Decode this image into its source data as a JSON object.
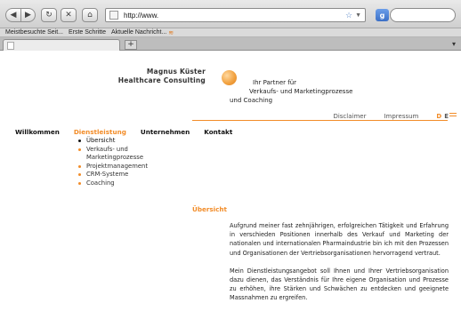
{
  "browser": {
    "url": "http://www.",
    "bookmarks": [
      "Meistbesuchte Seit...",
      "Erste Schritte",
      "Aktuelle Nachricht..."
    ],
    "new_tab_label": "+",
    "search_engine_label": "g"
  },
  "site": {
    "company_line1": "Magnus Küster",
    "company_line2": "Healthcare Consulting",
    "tagline_line1": "Ihr Partner für",
    "tagline_line2": "Verkaufs- und Marketingprozesse",
    "tagline_line3": "und Coaching",
    "accent_color": "#f28c28"
  },
  "service_links": {
    "disclaimer": "Disclaimer",
    "impressum": "Impressum",
    "lang_de": "D",
    "lang_en": "E"
  },
  "main_nav": {
    "willkommen": "Willkommen",
    "dienstleistung": "Dienstleistung",
    "unternehmen": "Unternehmen",
    "kontakt": "Kontakt"
  },
  "sub_nav": {
    "uebersicht": "Übersicht",
    "verkauf_line1": "Verkaufs- und",
    "verkauf_line2": "Marketingprozesse",
    "projektmanagement": "Projektmanagement",
    "crm": "CRM-Systeme",
    "coaching": "Coaching"
  },
  "content": {
    "title": "Übersicht",
    "paragraph1": "Aufgrund meiner fast zehnjährigen, erfolgreichen Tätigkeit und Erfahrung in verschieden Positionen innerhalb des Verkauf und Marketing der nationalen und internationalen Pharmaindustrie bin ich mit den Prozessen und Organisationen der Vertriebsorganisationen hervorragend vertraut.",
    "paragraph2": "Mein Dienstleistungsangebot soll Ihnen und Ihrer Vertriebsorganisation dazu dienen, das Verständnis für Ihre eigene Organisation und Prozesse zu erhöhen, ihre Stärken und Schwächen zu entdecken und geeignete Massnahmen zu ergreifen."
  }
}
